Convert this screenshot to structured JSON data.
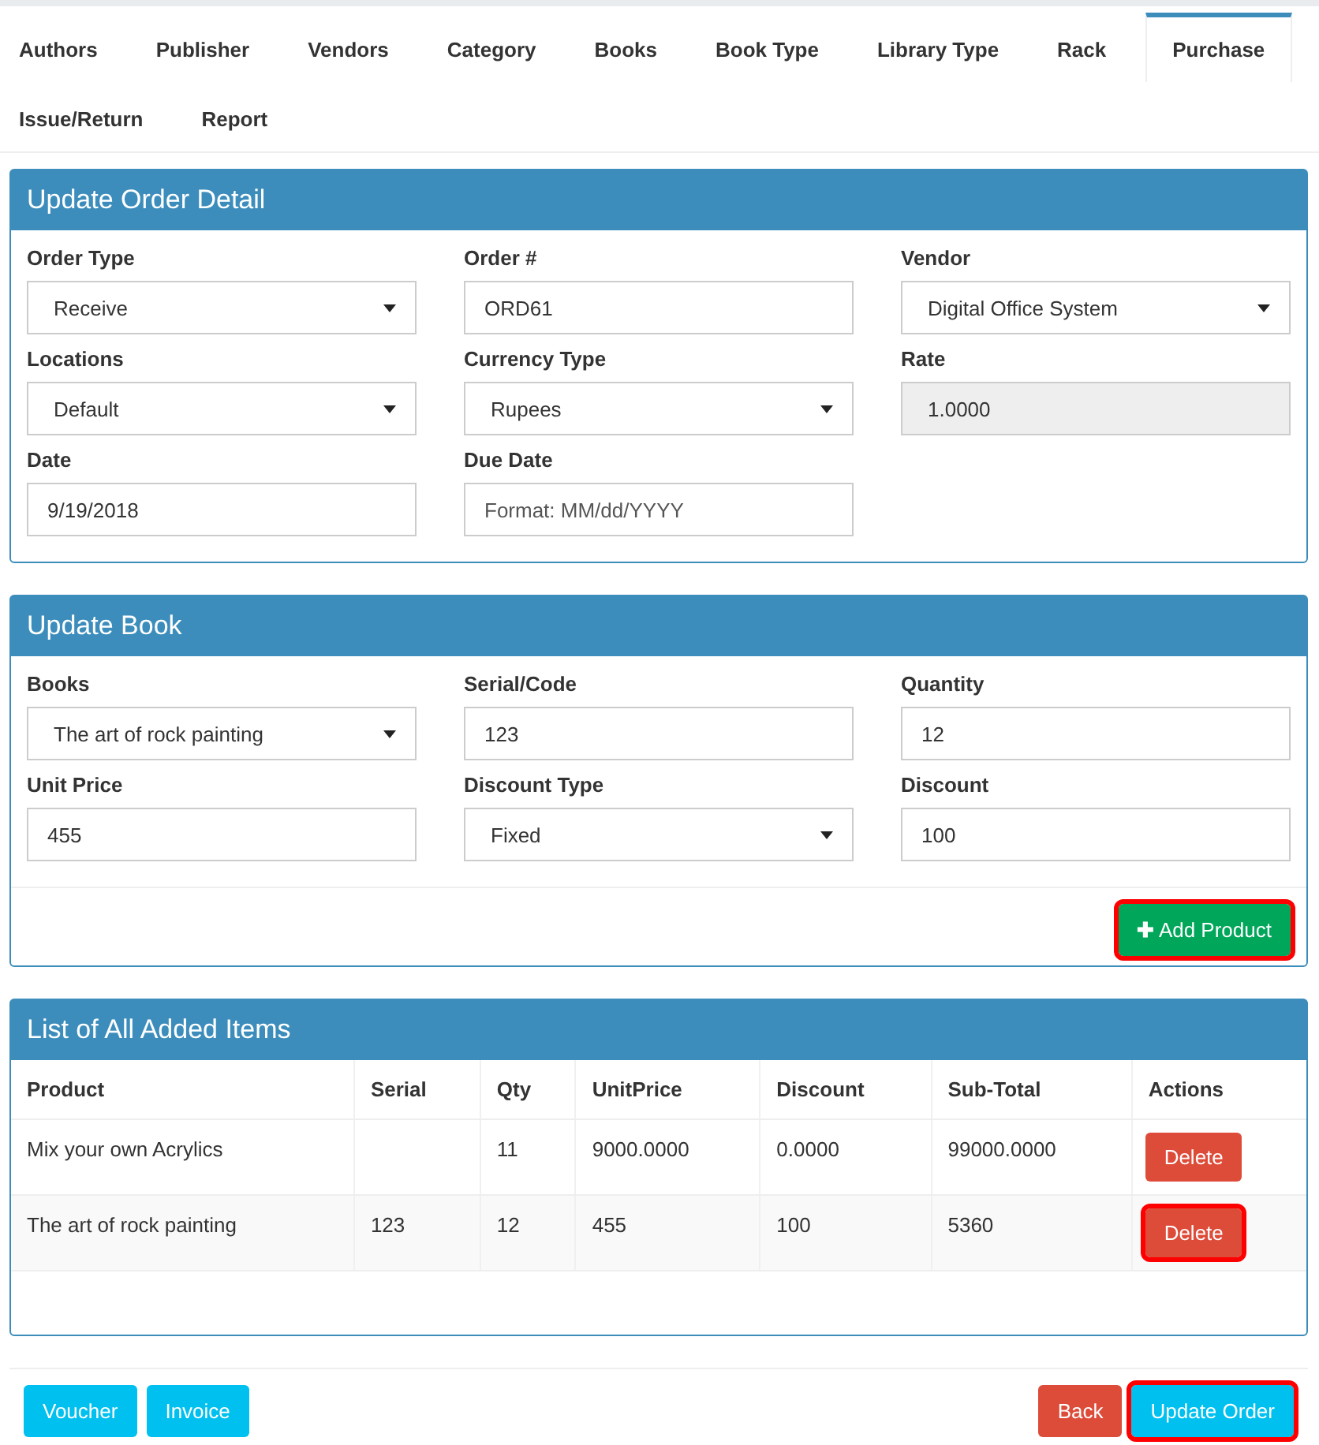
{
  "tabs": [
    {
      "label": "Authors",
      "selected": false
    },
    {
      "label": "Publisher",
      "selected": false
    },
    {
      "label": "Vendors",
      "selected": false
    },
    {
      "label": "Category",
      "selected": false
    },
    {
      "label": "Books",
      "selected": false
    },
    {
      "label": "Book Type",
      "selected": false
    },
    {
      "label": "Library Type",
      "selected": false
    },
    {
      "label": "Rack",
      "selected": false
    },
    {
      "label": "Purchase",
      "selected": true
    },
    {
      "label": "Issue/Return",
      "selected": false
    },
    {
      "label": "Report",
      "selected": false
    }
  ],
  "order_panel": {
    "title": "Update Order Detail",
    "fields": [
      {
        "label": "Order Type",
        "kind": "select",
        "value": "Receive"
      },
      {
        "label": "Order #",
        "kind": "input",
        "value": "ORD61"
      },
      {
        "label": "Vendor",
        "kind": "select",
        "value": "Digital Office System"
      },
      {
        "label": "Locations",
        "kind": "select",
        "value": "Default"
      },
      {
        "label": "Currency Type",
        "kind": "select",
        "value": "Rupees"
      },
      {
        "label": "Rate",
        "kind": "readonly",
        "value": "1.0000"
      },
      {
        "label": "Date",
        "kind": "input",
        "value": "9/19/2018"
      },
      {
        "label": "Due Date",
        "kind": "input",
        "placeholder": "Format: MM/dd/YYYY"
      }
    ]
  },
  "book_panel": {
    "title": "Update Book",
    "fields": [
      {
        "label": "Books",
        "kind": "select",
        "value": "The art of rock painting"
      },
      {
        "label": "Serial/Code",
        "kind": "input",
        "value": "123"
      },
      {
        "label": "Quantity",
        "kind": "input",
        "value": "12"
      },
      {
        "label": "Unit Price",
        "kind": "input",
        "value": "455"
      },
      {
        "label": "Discount Type",
        "kind": "select",
        "value": "Fixed"
      },
      {
        "label": "Discount",
        "kind": "input",
        "value": "100"
      }
    ],
    "add_button": {
      "icon": "✚",
      "label": "Add Product",
      "highlighted": true
    }
  },
  "items_panel": {
    "title": "List of All Added Items",
    "columns": [
      "Product",
      "Serial",
      "Qty",
      "UnitPrice",
      "Discount",
      "Sub-Total",
      "Actions"
    ],
    "rows": [
      {
        "cells": [
          "Mix your own Acrylics",
          "",
          "11",
          "9000.0000",
          "0.0000",
          "99000.0000"
        ],
        "action": "Delete",
        "highlighted": false
      },
      {
        "cells": [
          "The art of rock painting",
          "123",
          "12",
          "455",
          "100",
          "5360"
        ],
        "action": "Delete",
        "highlighted": true
      }
    ]
  },
  "footer": {
    "left_buttons": [
      {
        "label": "Voucher",
        "highlighted": false
      },
      {
        "label": "Invoice",
        "highlighted": false
      }
    ],
    "right_buttons": [
      {
        "label": "Back",
        "kind": "danger",
        "highlighted": false
      },
      {
        "label": "Update Order",
        "kind": "info",
        "highlighted": true
      }
    ]
  }
}
